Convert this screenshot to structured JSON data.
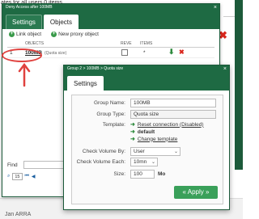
{
  "background": {
    "top_text": "ates for all users 0 items",
    "bottom_text": "Jan ARRA",
    "red_x": "✖"
  },
  "back_dialog": {
    "title": "Deny Access after 100MB",
    "close": "×",
    "tabs": [
      {
        "label": "Settings",
        "active": false
      },
      {
        "label": "Objects",
        "active": true
      }
    ],
    "links": {
      "link_object": "Link object",
      "new_proxy_object": "New proxy object"
    },
    "columns": {
      "objects": "OBJECTS",
      "reverse": "REVE",
      "items": "ITEMS"
    },
    "rows": [
      {
        "index": "1",
        "name": "100MB",
        "type": "(Quota size)",
        "items": "*"
      }
    ],
    "find_label": "Find",
    "pager": {
      "page_size": "15"
    }
  },
  "front_dialog": {
    "title": "Group 2 > 100MB > Quota size",
    "close": "×",
    "tab": "Settings",
    "fields": {
      "group_name_label": "Group Name:",
      "group_name_value": "100MB",
      "group_type_label": "Group Type:",
      "group_type_value": "Quota size",
      "template_label": "Template:",
      "template_reset": "Reset connection (Disabled)",
      "template_default": "default",
      "template_change": "Change template",
      "check_volume_by_label": "Check Volume By:",
      "check_volume_by_value": "User",
      "check_volume_each_label": "Check Volume Each:",
      "check_volume_each_value": "10mn",
      "size_label": "Size:",
      "size_value": "100",
      "size_unit": "Mo"
    },
    "apply_label": "« Apply »"
  },
  "colors": {
    "brand_green": "#1e6a43",
    "apply_green": "#3aa05a",
    "annotation_red": "#e0413e"
  }
}
